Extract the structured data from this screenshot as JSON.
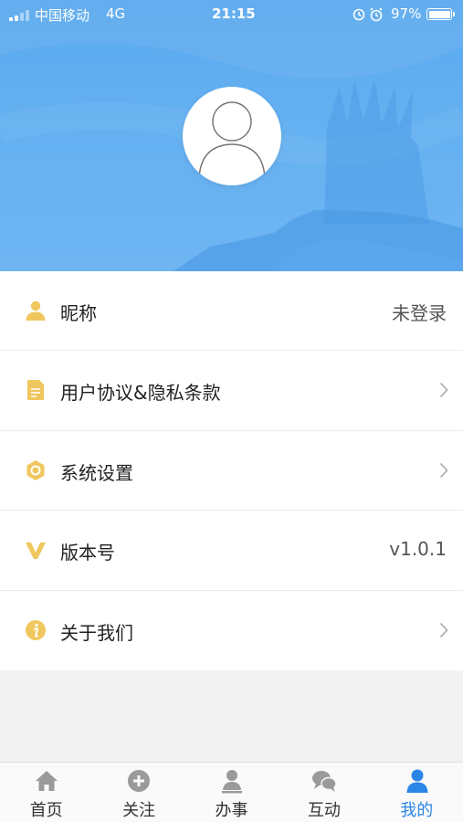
{
  "status_bar": {
    "carrier": "中国移动",
    "network": "4G",
    "time": "21:15",
    "battery_percent": "97%",
    "icons": [
      "signal-icon",
      "rotation-lock-icon",
      "alarm-icon",
      "battery-icon"
    ]
  },
  "profile": {
    "avatar_icon": "default-avatar-icon"
  },
  "menu": [
    {
      "label": "昵称",
      "value": "未登录",
      "icon": "user-icon",
      "has_chevron": false
    },
    {
      "label": "用户协议&隐私条款",
      "value": "",
      "icon": "document-icon",
      "has_chevron": true
    },
    {
      "label": "系统设置",
      "value": "",
      "icon": "settings-icon",
      "has_chevron": true
    },
    {
      "label": "版本号",
      "value": "v1.0.1",
      "icon": "version-icon",
      "has_chevron": false
    },
    {
      "label": "关于我们",
      "value": "",
      "icon": "info-icon",
      "has_chevron": true
    }
  ],
  "tabbar": {
    "active_index": 4,
    "items": [
      {
        "label": "首页",
        "icon": "home-icon"
      },
      {
        "label": "关注",
        "icon": "plus-circle-icon"
      },
      {
        "label": "办事",
        "icon": "person-task-icon"
      },
      {
        "label": "互动",
        "icon": "chat-bubbles-icon"
      },
      {
        "label": "我的",
        "icon": "profile-icon"
      }
    ]
  },
  "colors": {
    "header_blue": "#5aa9ef",
    "accent_blue": "#2b86e8",
    "icon_yellow": "#f0c75e",
    "tab_inactive": "#9a9a9a"
  }
}
